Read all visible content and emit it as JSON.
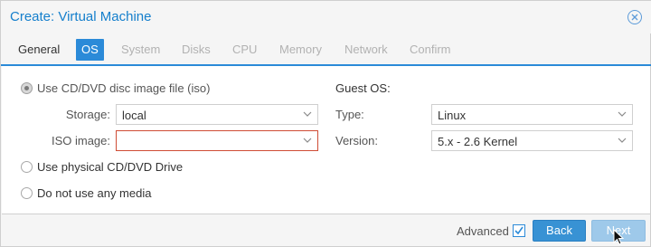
{
  "window": {
    "title": "Create: Virtual Machine"
  },
  "tabs": [
    {
      "label": "General",
      "state": "normal"
    },
    {
      "label": "OS",
      "state": "active"
    },
    {
      "label": "System",
      "state": "disabled"
    },
    {
      "label": "Disks",
      "state": "disabled"
    },
    {
      "label": "CPU",
      "state": "disabled"
    },
    {
      "label": "Memory",
      "state": "disabled"
    },
    {
      "label": "Network",
      "state": "disabled"
    },
    {
      "label": "Confirm",
      "state": "disabled"
    }
  ],
  "media": {
    "option_iso": "Use CD/DVD disc image file (iso)",
    "storage_label": "Storage:",
    "storage_value": "local",
    "iso_label": "ISO image:",
    "iso_value": "",
    "option_physical": "Use physical CD/DVD Drive",
    "option_none": "Do not use any media"
  },
  "guest": {
    "title": "Guest OS:",
    "type_label": "Type:",
    "type_value": "Linux",
    "version_label": "Version:",
    "version_value": "5.x - 2.6 Kernel"
  },
  "footer": {
    "advanced_label": "Advanced",
    "advanced_checked": true,
    "back_label": "Back",
    "next_label": "Next"
  },
  "colors": {
    "accent": "#2b8ad8",
    "title": "#157fcc",
    "invalid_border": "#cf4c35"
  }
}
